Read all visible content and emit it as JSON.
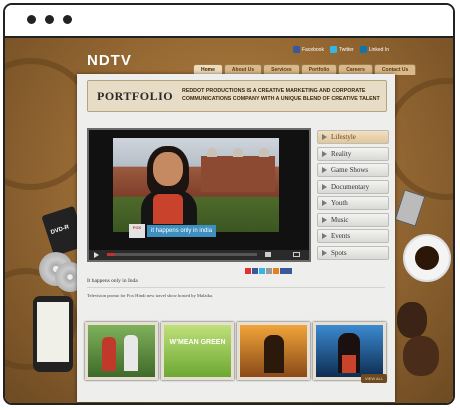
{
  "brand": {
    "logo": "NDTV"
  },
  "social": [
    {
      "label": "Facebook",
      "icon": "facebook-icon",
      "color": "#3b5998"
    },
    {
      "label": "Twitter",
      "icon": "twitter-icon",
      "color": "#33b5e5"
    },
    {
      "label": "Linked In",
      "icon": "linkedin-icon",
      "color": "#0e76a8"
    }
  ],
  "nav": [
    {
      "label": "Home",
      "active": true
    },
    {
      "label": "About Us"
    },
    {
      "label": "Services"
    },
    {
      "label": "Portfolio"
    },
    {
      "label": "Careers"
    },
    {
      "label": "Contact Us"
    }
  ],
  "banner": {
    "title": "PORTFOLIO",
    "tagline": "REDDOT PRODUCTIONS IS A CREATIVE MARKETING AND CORPORATE COMMUNICATIONS COMPANY WITH A UNIQUE BLEND OF CREATIVE TALENT"
  },
  "video": {
    "caption": "it happens only in india",
    "caption_logo": "FOX",
    "progress": 0.05
  },
  "menu": [
    {
      "label": "Lifestyle",
      "active": true
    },
    {
      "label": "Reality"
    },
    {
      "label": "Game Shows"
    },
    {
      "label": "Documentary"
    },
    {
      "label": "Youth"
    },
    {
      "label": "Music"
    },
    {
      "label": "Events"
    },
    {
      "label": "Spots"
    }
  ],
  "video_info": {
    "title": "It happens only in Inda",
    "description": "Television promo for Fox Hindi new travel show hosted by Malaika."
  },
  "thumbnails": [
    {
      "label": "",
      "colors": [
        "#6c9a4a",
        "#2a2a2a"
      ]
    },
    {
      "label": "W’MEAN GREEN",
      "colors": [
        "#7ab23a",
        "#e8e8c8"
      ]
    },
    {
      "label": "",
      "colors": [
        "#d88a2a",
        "#6b3a12"
      ]
    },
    {
      "label": "",
      "colors": [
        "#1f6fb0",
        "#0c2a4a"
      ]
    }
  ],
  "view_all": "VIEW ALL",
  "dvd_label": "DVD-R",
  "colors": {
    "accent": "#c9432c",
    "menu_active": "#6a3c10",
    "caption": "#3d8fc0"
  }
}
